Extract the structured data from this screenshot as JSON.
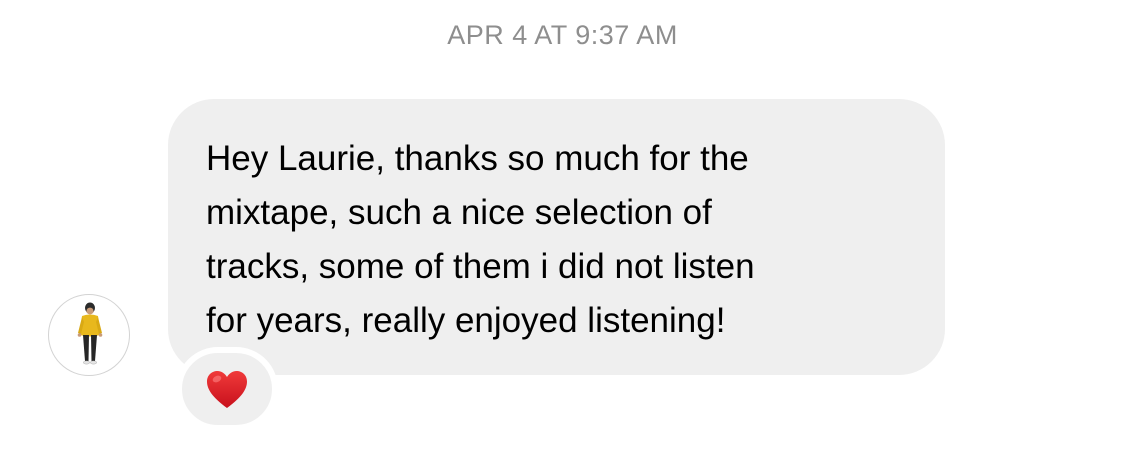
{
  "thread": {
    "timestamp": "APR 4 AT 9:37 AM"
  },
  "message": {
    "sender_avatar_icon": "person-in-yellow-jacket-avatar",
    "text": "Hey Laurie, thanks so much for the\nmixtape, such a nice selection of\ntracks, some of them i did not listen\nfor years, really enjoyed listening!",
    "bubble_color": "#efefef",
    "reaction": {
      "icon": "red-heart-icon",
      "color": "#e0212b"
    }
  }
}
